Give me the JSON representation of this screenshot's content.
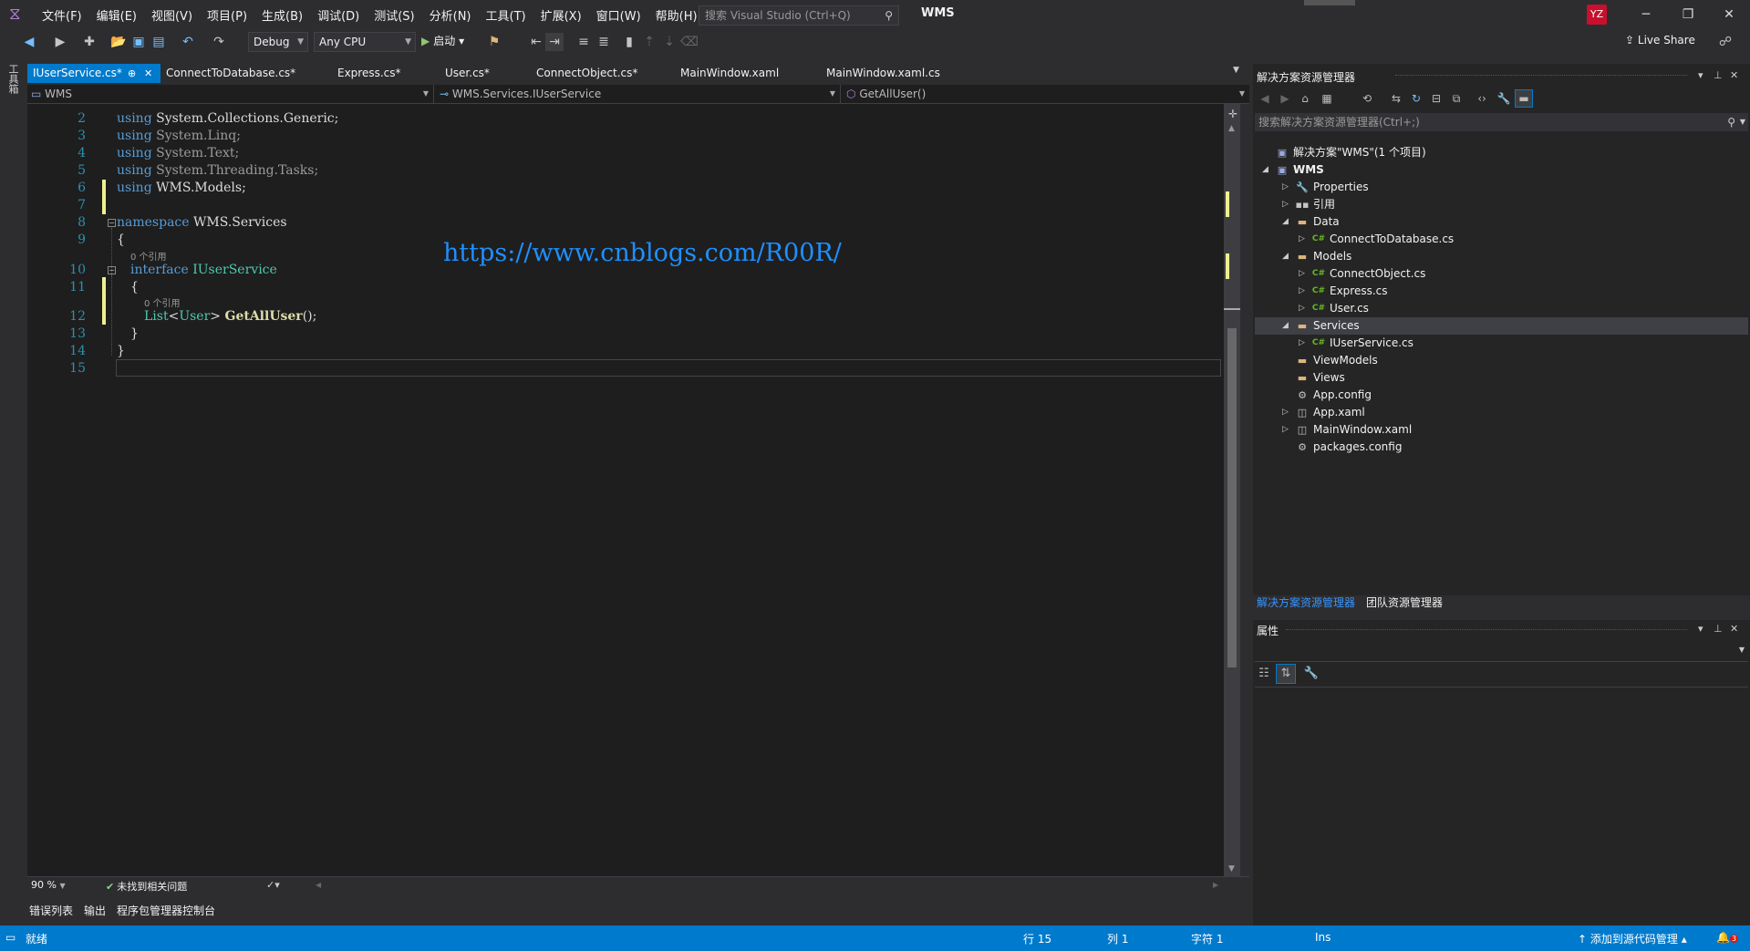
{
  "menu": {
    "items": [
      "文件(F)",
      "编辑(E)",
      "视图(V)",
      "项目(P)",
      "生成(B)",
      "调试(D)",
      "测试(S)",
      "分析(N)",
      "工具(T)",
      "扩展(X)",
      "窗口(W)",
      "帮助(H)"
    ],
    "search_placeholder": "搜索 Visual Studio (Ctrl+Q)",
    "solution_name": "WMS",
    "avatar_initials": "YZ"
  },
  "toolbar": {
    "config": "Debug",
    "platform": "Any CPU",
    "start_label": "启动",
    "live_share": "Live Share"
  },
  "toolbox_label": "工具箱",
  "tabs": [
    {
      "label": "IUserService.cs*",
      "active": true
    },
    {
      "label": "ConnectToDatabase.cs*"
    },
    {
      "label": "Express.cs*"
    },
    {
      "label": "User.cs*"
    },
    {
      "label": "ConnectObject.cs*"
    },
    {
      "label": "MainWindow.xaml"
    },
    {
      "label": "MainWindow.xaml.cs"
    }
  ],
  "navbar": {
    "project": "WMS",
    "type": "WMS.Services.IUserService",
    "member": "GetAllUser()"
  },
  "code": {
    "line_numbers": [
      "2",
      "3",
      "4",
      "5",
      "6",
      "7",
      "8",
      "9",
      "10",
      "11",
      "12",
      "13",
      "14",
      "15"
    ],
    "using_kw": "using",
    "usings": [
      "System.Collections.Generic;",
      "System.Linq;",
      "System.Text;",
      "System.Threading.Tasks;",
      "WMS.Models;"
    ],
    "namespace_kw": "namespace",
    "namespace_name": "WMS.Services",
    "open_brace": "{",
    "close_brace": "}",
    "codelens_refs": "0 个引用",
    "interface_kw": "interface",
    "interface_name": "IUserService",
    "list_type": "List",
    "lt": "<",
    "user_type": "User",
    "gt": ">",
    "method_name": "GetAllUser",
    "method_tail": "();",
    "watermark": "https://www.cnblogs.com/R00R/"
  },
  "editor_status": {
    "zoom": "90 %",
    "issues": "未找到相关问题"
  },
  "bottom_tabs": [
    "错误列表",
    "输出",
    "程序包管理器控制台"
  ],
  "statusbar": {
    "ready": "就绪",
    "line": "行 15",
    "col": "列 1",
    "ch": "字符 1",
    "mode": "Ins",
    "source_control": "添加到源代码管理",
    "notifications": "3"
  },
  "solution_explorer": {
    "title": "解决方案资源管理器",
    "search_placeholder": "搜索解决方案资源管理器(Ctrl+;)",
    "tree": [
      {
        "label": "解决方案\"WMS\"(1 个项目)",
        "icon": "solution-icon",
        "depth": 0,
        "arrow": ""
      },
      {
        "label": "WMS",
        "icon": "project-icon",
        "depth": 0,
        "arrow": "expanded",
        "bold": true
      },
      {
        "label": "Properties",
        "icon": "wrench-icon",
        "depth": 1,
        "arrow": "collapsed"
      },
      {
        "label": "引用",
        "icon": "references-icon",
        "depth": 1,
        "arrow": "collapsed"
      },
      {
        "label": "Data",
        "icon": "folder-icon",
        "depth": 1,
        "arrow": "expanded"
      },
      {
        "label": "ConnectToDatabase.cs",
        "icon": "csharp-file-icon",
        "depth": 2,
        "arrow": "collapsed"
      },
      {
        "label": "Models",
        "icon": "folder-icon",
        "depth": 1,
        "arrow": "expanded"
      },
      {
        "label": "ConnectObject.cs",
        "icon": "csharp-file-icon",
        "depth": 2,
        "arrow": "collapsed"
      },
      {
        "label": "Express.cs",
        "icon": "csharp-file-icon",
        "depth": 2,
        "arrow": "collapsed"
      },
      {
        "label": "User.cs",
        "icon": "csharp-file-icon",
        "depth": 2,
        "arrow": "collapsed"
      },
      {
        "label": "Services",
        "icon": "folder-icon",
        "depth": 1,
        "arrow": "expanded",
        "selected": true
      },
      {
        "label": "IUserService.cs",
        "icon": "csharp-file-icon",
        "depth": 2,
        "arrow": "collapsed"
      },
      {
        "label": "ViewModels",
        "icon": "folder-icon",
        "depth": 1,
        "arrow": ""
      },
      {
        "label": "Views",
        "icon": "folder-icon",
        "depth": 1,
        "arrow": ""
      },
      {
        "label": "App.config",
        "icon": "config-file-icon",
        "depth": 1,
        "arrow": ""
      },
      {
        "label": "App.xaml",
        "icon": "xaml-file-icon",
        "depth": 1,
        "arrow": "collapsed"
      },
      {
        "label": "MainWindow.xaml",
        "icon": "xaml-file-icon",
        "depth": 1,
        "arrow": "collapsed"
      },
      {
        "label": "packages.config",
        "icon": "config-file-icon",
        "depth": 1,
        "arrow": ""
      }
    ],
    "bottom_tabs": [
      "解决方案资源管理器",
      "团队资源管理器"
    ]
  },
  "properties": {
    "title": "属性"
  },
  "colors": {
    "accent": "#007acc",
    "background": "#1e1e1e",
    "chrome": "#2d2d30",
    "keyword": "#569cd6",
    "type": "#4ec9b0",
    "method": "#dcdcaa",
    "line_number": "#2b91af",
    "watermark": "#1e90ff"
  }
}
